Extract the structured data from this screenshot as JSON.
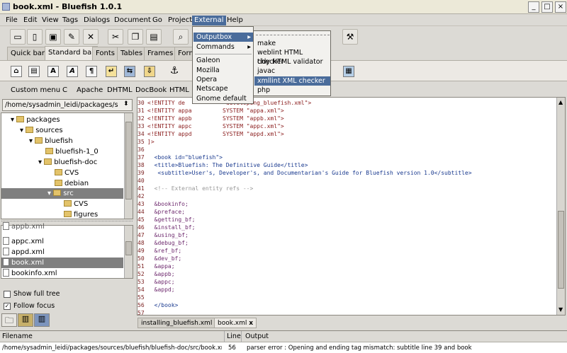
{
  "window": {
    "title": "book.xml - Bluefish 1.0.1"
  },
  "menubar": [
    "File",
    "Edit",
    "View",
    "Tags",
    "Dialogs",
    "Document",
    "Go",
    "Project",
    "External",
    "Help"
  ],
  "tabs": [
    "Quick bar",
    "Standard bar",
    "Fonts",
    "Tables",
    "Frames",
    "Form"
  ],
  "custom_menu": [
    "Custom menu",
    "C",
    "Apache",
    "DHTML",
    "DocBook",
    "HTML"
  ],
  "filebrowser": {
    "path": "/home/sysadmin_leidi/packages/sourc",
    "tree": [
      "packages",
      "sources",
      "bluefish",
      "bluefish-1_0",
      "bluefish-doc",
      "CVS",
      "debian",
      "src",
      "CVS",
      "figures"
    ],
    "files": [
      "appc.xml",
      "appd.xml",
      "book.xml",
      "bookinfo.xml"
    ],
    "partial": "appb.xml",
    "show_full_tree": "Show full tree",
    "follow_focus": "Follow focus"
  },
  "editor": {
    "lines": [
      [
        "30",
        "<!ENTITY de",
        "*developing_bluefish.xml\">"
      ],
      [
        "31",
        "<!ENTITY appa",
        "SYSTEM \"appa.xml\">"
      ],
      [
        "32",
        "<!ENTITY appb",
        "SYSTEM \"appb.xml\">"
      ],
      [
        "33",
        "<!ENTITY appc",
        "SYSTEM \"appc.xml\">"
      ],
      [
        "34",
        "<!ENTITY appd",
        "SYSTEM \"appd.xml\">"
      ],
      [
        "35",
        "]>",
        ""
      ],
      [
        "36",
        "",
        ""
      ],
      [
        "37",
        "<book id=\"bluefish\">",
        ""
      ],
      [
        "38",
        "<title>Bluefish: The Definitive Guide</title>",
        ""
      ],
      [
        "39",
        " <subtitle>User's, Developer's, and Documentarian's Guide for Bluefish version 1.0</subtitle>",
        ""
      ],
      [
        "40",
        "",
        ""
      ],
      [
        "41",
        "<!-- External entity refs -->",
        ""
      ],
      [
        "42",
        "",
        ""
      ],
      [
        "43",
        "&bookinfo;",
        ""
      ],
      [
        "44",
        "&preface;",
        ""
      ],
      [
        "45",
        "&getting_bf;",
        ""
      ],
      [
        "46",
        "&install_bf;",
        ""
      ],
      [
        "47",
        "&using_bf;",
        ""
      ],
      [
        "48",
        "&debug_bf;",
        ""
      ],
      [
        "49",
        "&ref_bf;",
        ""
      ],
      [
        "50",
        "&dev_bf;",
        ""
      ],
      [
        "51",
        "&appa;",
        ""
      ],
      [
        "52",
        "&appb;",
        ""
      ],
      [
        "53",
        "&appc;",
        ""
      ],
      [
        "54",
        "&appd;",
        ""
      ],
      [
        "55",
        "",
        ""
      ],
      [
        "56",
        "</book>",
        ""
      ],
      [
        "57",
        "",
        ""
      ]
    ],
    "tabs": [
      "installing_bluefish.xml",
      "book.xml"
    ]
  },
  "external_menu": {
    "items": [
      "Outputbox",
      "Commands",
      "Galeon",
      "Mozilla",
      "Opera",
      "Netscape",
      "Gnome default"
    ]
  },
  "outputbox_menu": {
    "items": [
      "make",
      "weblint HTML checker",
      "tidy HTML validator",
      "javac",
      "xmllint XML checker",
      "php"
    ],
    "highlighted": "xmllint XML checker"
  },
  "output": {
    "headers": [
      "Filename",
      "Line",
      "Output"
    ],
    "row": {
      "filename": "/home/sysadmin_leidi/packages/sources/bluefish/bluefish-doc/src/book.xml",
      "line": "56",
      "output": "parser error : Opening and ending tag mismatch: subtitle line 39 and book"
    }
  }
}
